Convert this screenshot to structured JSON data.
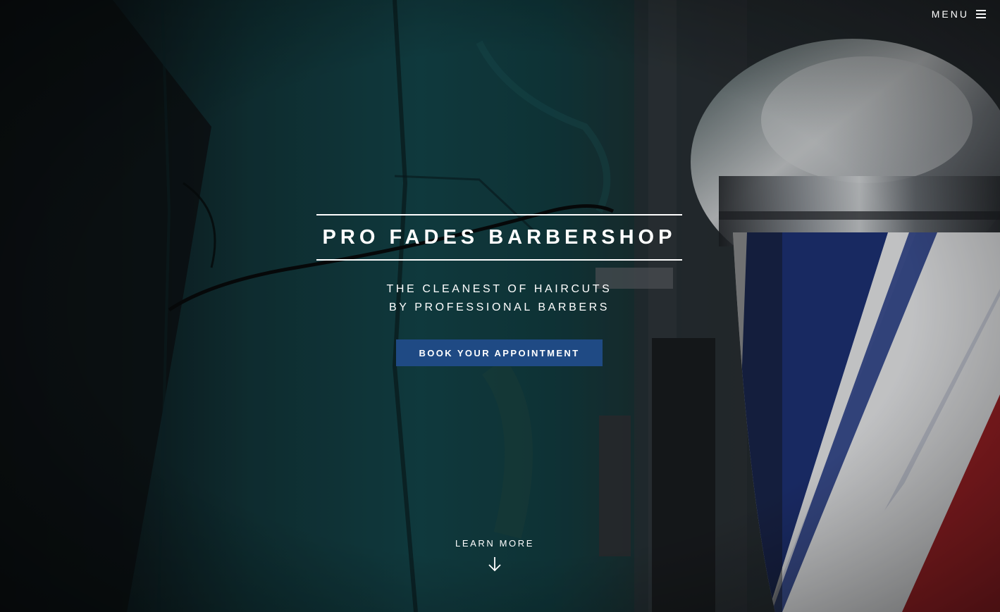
{
  "nav": {
    "menu_label": "MENU",
    "menu_icon": "hamburger-icon"
  },
  "hero": {
    "title": "PRO FADES BARBERSHOP",
    "tagline_line1": "THE CLEANEST OF HAIRCUTS",
    "tagline_line2": "BY PROFESSIONAL BARBERS",
    "cta_label": "BOOK YOUR APPOINTMENT",
    "learn_more_label": "LEARN MORE",
    "learn_more_icon": "arrow-down-icon"
  },
  "colors": {
    "accent": "#1f4a84",
    "text": "#ffffff",
    "background_teal": "#0f3b3f"
  }
}
